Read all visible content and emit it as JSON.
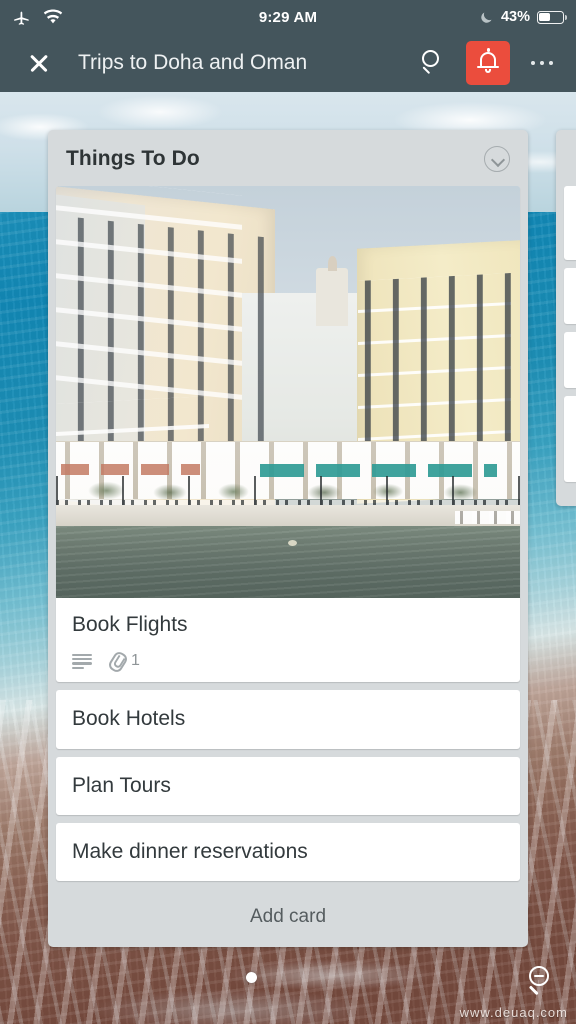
{
  "status_bar": {
    "airplane_icon": "airplane-mode-icon",
    "wifi_icon": "wifi-icon",
    "time": "9:29 AM",
    "moon_icon": "do-not-disturb-moon-icon",
    "battery_percent": "43%",
    "battery_level": 43
  },
  "toolbar": {
    "close_label": "close-icon",
    "title": "Trips to Doha and Oman",
    "search_label": "search-icon",
    "notifications_label": "bell-icon",
    "overflow_label": "more-options-icon",
    "accent_color": "#eb4d3d",
    "bar_color": "#44555c"
  },
  "list": {
    "title": "Things To Do",
    "collapse_label": "chevron-down-icon",
    "background_color": "#d6dadc",
    "add_card_label": "Add card",
    "cards": [
      {
        "title": "Book Flights",
        "has_cover": true,
        "cover_alt": "Qanat Quartier canal buildings in Doha",
        "description_badge": "description-icon",
        "attachment_badge": "attachment-icon",
        "attachment_count": "1"
      },
      {
        "title": "Book Hotels",
        "has_cover": false
      },
      {
        "title": "Plan Tours",
        "has_cover": false
      },
      {
        "title": "Make dinner reservations",
        "has_cover": false
      }
    ]
  },
  "board": {
    "background_alt": "aerial beach and ocean photo",
    "page_indicator_label": "page-indicator-dot",
    "zoom_out_label": "zoom-out-icon"
  },
  "watermark": {
    "text": "www.deuaq.com"
  }
}
